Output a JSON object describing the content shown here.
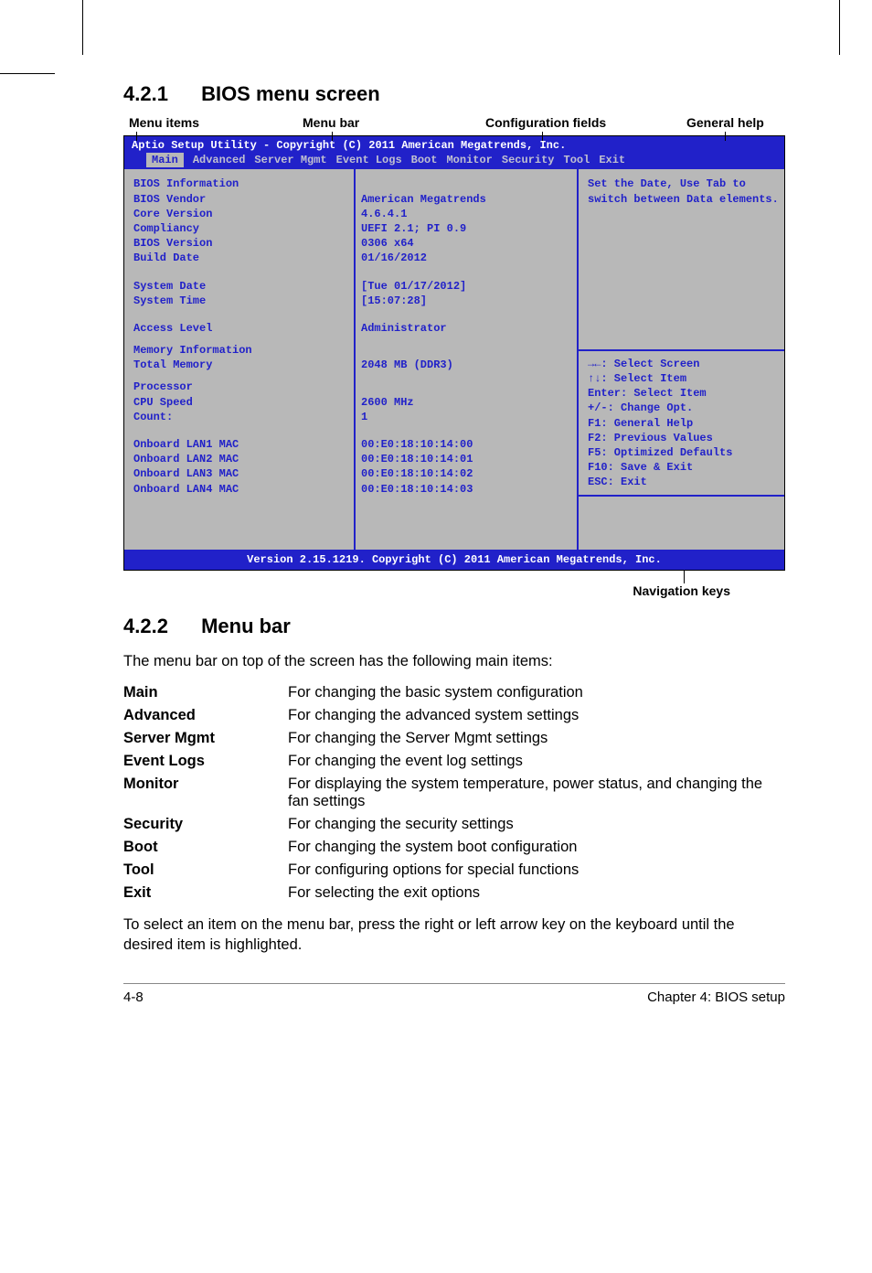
{
  "sections": {
    "s1_num": "4.2.1",
    "s1_title": "BIOS menu screen",
    "s2_num": "4.2.2",
    "s2_title": "Menu bar"
  },
  "annotations": {
    "menu_items": "Menu items",
    "menu_bar": "Menu bar",
    "config_fields": "Configuration fields",
    "general_help": "General help",
    "nav_keys": "Navigation keys"
  },
  "bios": {
    "header": "Aptio Setup Utility - Copyright (C) 2011 American Megatrends, Inc.",
    "tabs": [
      "Main",
      "Advanced",
      "Server Mgmt",
      "Event Logs",
      "Boot",
      "Monitor",
      "Security",
      "Tool",
      "Exit"
    ],
    "left": {
      "heading1": "BIOS Information",
      "vendor_l": "BIOS Vendor",
      "core_l": "Core Version",
      "comp_l": "Compliancy",
      "ver_l": "BIOS Version",
      "build_l": "Build Date",
      "date_l": "System Date",
      "time_l": "System Time",
      "access_l": "Access Level",
      "heading2": "Memory Information",
      "totmem_l": "Total Memory",
      "proc_l": "Processor",
      "cpu_l": "CPU Speed",
      "count_l": "Count:",
      "lan1": "Onboard LAN1 MAC",
      "lan2": "Onboard LAN2 MAC",
      "lan3": "Onboard LAN3 MAC",
      "lan4": "Onboard LAN4 MAC"
    },
    "mid": {
      "vendor": "American Megatrends",
      "core": "4.6.4.1",
      "comp": "UEFI 2.1; PI 0.9",
      "ver": "0306 x64",
      "build": "01/16/2012",
      "date": "[Tue 01/17/2012]",
      "time": "[15:07:28]",
      "access": "Administrator",
      "totmem": "2048 MB (DDR3)",
      "cpu": "2600 MHz",
      "count": "1",
      "mac1": "00:E0:18:10:14:00",
      "mac2": "00:E0:18:10:14:01",
      "mac3": "00:E0:18:10:14:02",
      "mac4": "00:E0:18:10:14:03"
    },
    "right": {
      "help1": "Set the Date, Use Tab to",
      "help2": "switch between Data elements.",
      "k1": "→←: Select Screen",
      "k2": "↑↓:  Select Item",
      "k3": "Enter: Select Item",
      "k4": "+/-: Change Opt.",
      "k5": "F1: General Help",
      "k6": "F2: Previous Values",
      "k7": "F5: Optimized Defaults",
      "k8": "F10: Save & Exit",
      "k9": "ESC: Exit"
    },
    "footer": "Version 2.15.1219. Copyright (C) 2011 American Megatrends, Inc."
  },
  "menubar_intro": "The menu bar on top of the screen has the following main items:",
  "menubar_items": {
    "main_t": "Main",
    "main_d": "For changing the basic system configuration",
    "adv_t": "Advanced",
    "adv_d": "For changing the advanced system settings",
    "srv_t": "Server Mgmt",
    "srv_d": "For changing the Server Mgmt settings",
    "evt_t": "Event Logs",
    "evt_d": "For changing the event log settings",
    "mon_t": "Monitor",
    "mon_d": "For displaying the system temperature, power status, and changing the fan settings",
    "sec_t": "Security",
    "sec_d": "For changing the security settings",
    "boot_t": "Boot",
    "boot_d": "For changing the system boot configuration",
    "tool_t": "Tool",
    "tool_d": "For configuring options for special functions",
    "exit_t": "Exit",
    "exit_d": "For selecting the exit options"
  },
  "menubar_note": "To select an item on the menu bar, press the right or left arrow key on the keyboard until the desired item is highlighted.",
  "footer": {
    "left": "4-8",
    "right": "Chapter 4: BIOS setup"
  }
}
